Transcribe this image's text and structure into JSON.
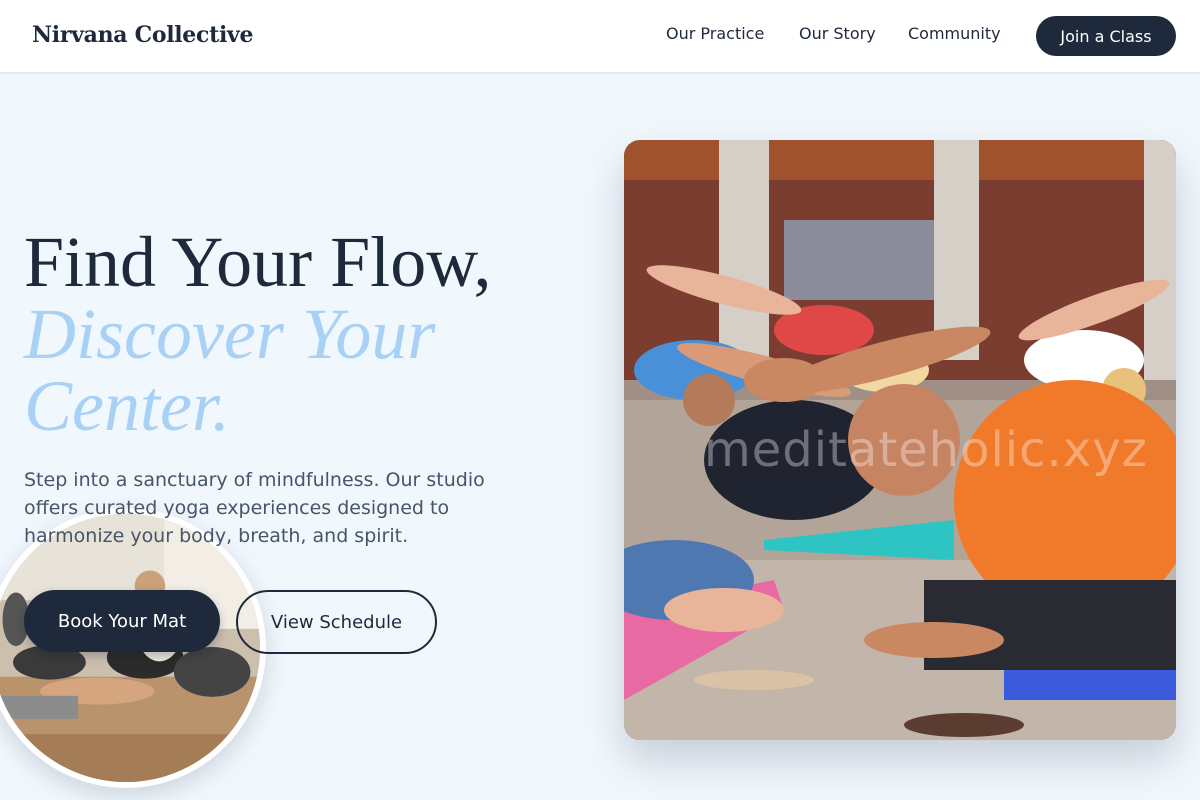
{
  "header": {
    "logo": "Nirvana Collective",
    "nav": [
      "Our Practice",
      "Our Story",
      "Community"
    ],
    "cta": "Join a Class"
  },
  "hero": {
    "headline_line1": "Find Your Flow,",
    "headline_line2": "Discover Your",
    "headline_line3": "Center.",
    "subtitle": "Step into a sanctuary of mindfulness. Our studio offers curated yoga experiences designed to harmonize your body, breath, and spirit.",
    "primary_button": "Book Your Mat",
    "secondary_button": "View Schedule"
  },
  "image": {
    "watermark": "meditateholic.xyz"
  },
  "colors": {
    "background": "#f0f7fd",
    "primary": "#1e293b",
    "accent": "#a8d1f5",
    "text_muted": "#475569"
  }
}
